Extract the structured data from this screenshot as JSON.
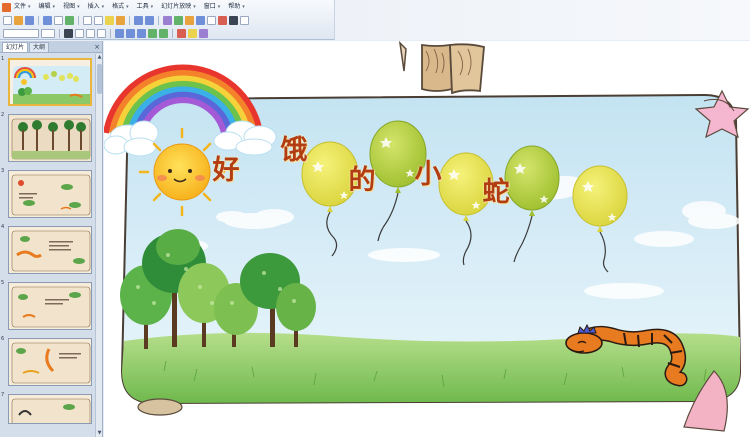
{
  "menu": {
    "items": [
      {
        "label": "文件"
      },
      {
        "label": "编辑"
      },
      {
        "label": "视图"
      },
      {
        "label": "插入"
      },
      {
        "label": "格式"
      },
      {
        "label": "工具"
      },
      {
        "label": "幻灯片放映"
      },
      {
        "label": "窗口"
      },
      {
        "label": "帮助"
      }
    ]
  },
  "pane": {
    "tabs": [
      {
        "label": "幻灯片",
        "active": true
      },
      {
        "label": "大纲",
        "active": false
      }
    ],
    "close_symbol": "×",
    "slide_numbers": [
      "1",
      "2",
      "3",
      "4",
      "5",
      "6",
      "7"
    ]
  },
  "slide": {
    "title_chars": [
      "好",
      "饿",
      "的",
      "小",
      "蛇"
    ],
    "colors": {
      "balloon": "#e6e35a",
      "balloon_dot": "#fff4b2",
      "text": "#b23d12",
      "snake": "#e87b1f",
      "sky": "#cfe8f3",
      "grass": "#7cc25b",
      "frame": "#5a4a3c"
    }
  },
  "icons": [
    "rainbow-icon",
    "sun-icon",
    "snake-icon",
    "tree-icon",
    "star-icon",
    "cloud-icon"
  ]
}
